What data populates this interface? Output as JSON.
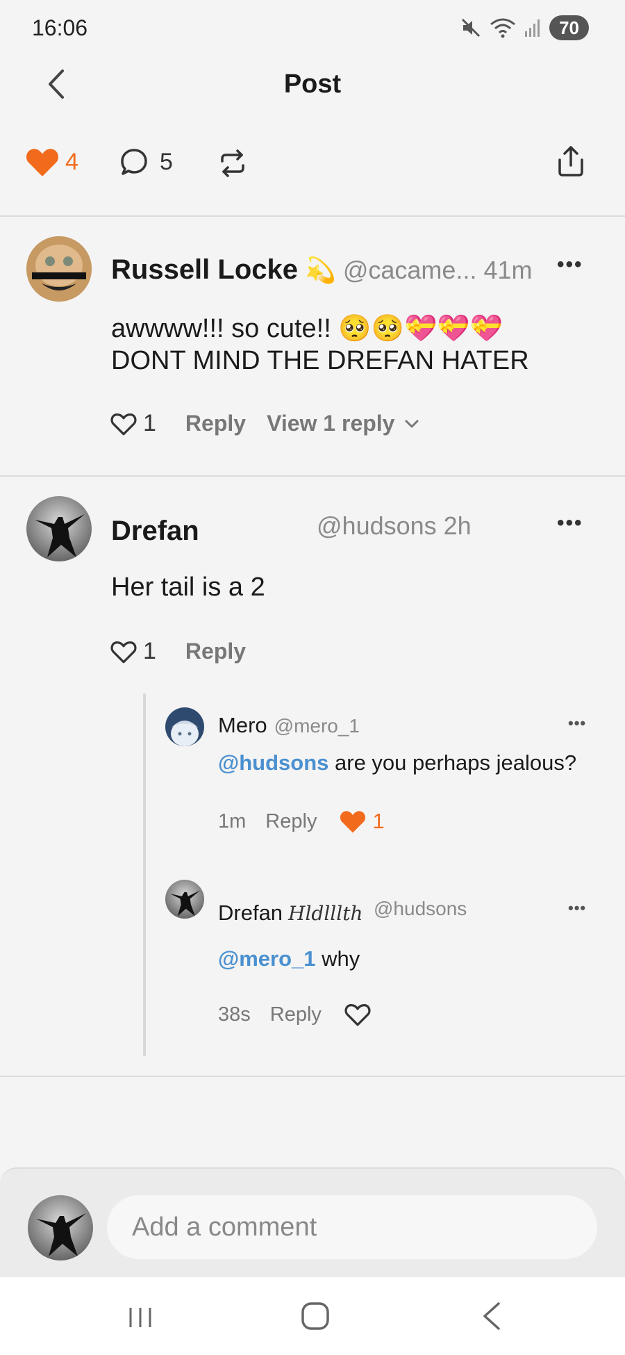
{
  "status_bar": {
    "time": "16:06",
    "battery": "70"
  },
  "header": {
    "title": "Post"
  },
  "post_actions": {
    "likes": "4",
    "comments": "5"
  },
  "comments": [
    {
      "name": "Russell Locke",
      "badge": "💫",
      "handle": "@cacame...",
      "time": "41m",
      "text_line1": "awwww!!! so cute!! 🥺🥺💝💝💝",
      "text_line2": "DONT MIND THE DREFAN HATER",
      "likes": "1",
      "reply_label": "Reply",
      "view_replies_label": "View 1 reply"
    },
    {
      "name": "Drefan",
      "handle": "@hudsons",
      "time": "2h",
      "text": "Her tail is a 2",
      "likes": "1",
      "reply_label": "Reply",
      "replies": [
        {
          "name": "Mero",
          "handle": "@mero_1",
          "mention": "@hudsons",
          "text": " are you perhaps jealous?",
          "time": "1m",
          "reply_label": "Reply",
          "likes": "1"
        },
        {
          "name": "Drefan",
          "name_suffix": "Hldlllth",
          "handle": "@hudsons",
          "mention": "@mero_1",
          "text": " why",
          "time": "38s",
          "reply_label": "Reply"
        }
      ]
    }
  ],
  "composer": {
    "placeholder": "Add a comment"
  },
  "colors": {
    "accent": "#f26b1d",
    "mention": "#4a90d0"
  },
  "icons": {
    "back": "back-arrow-icon",
    "like": "heart-icon",
    "comment": "comment-bubble-icon",
    "repost": "repost-icon",
    "share": "share-icon",
    "more": "more-dots-icon"
  }
}
